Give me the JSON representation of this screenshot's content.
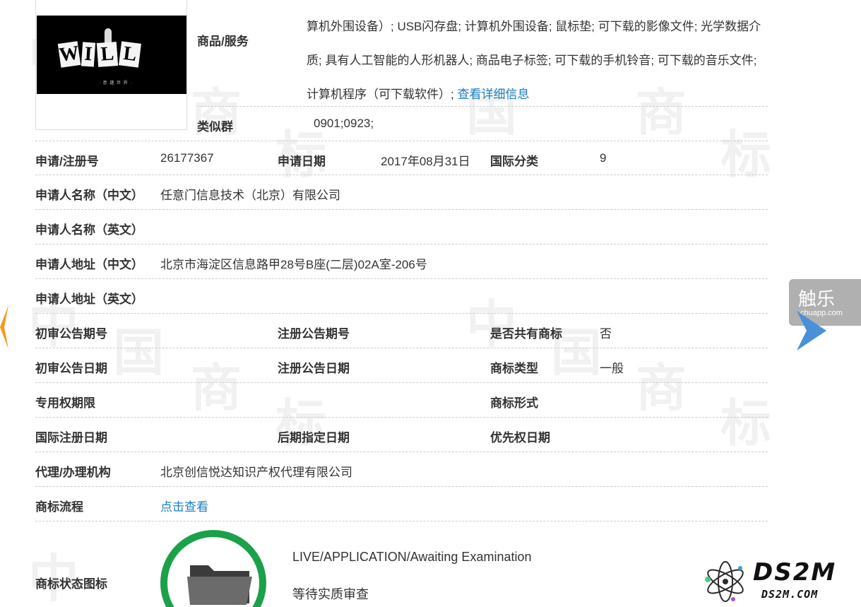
{
  "watermark": "中国商标",
  "logo": {
    "alt": "WILL trademark image",
    "letters": [
      "W",
      "I",
      "L",
      "L"
    ],
    "subtitle": "· 意 趣 世 界 ·"
  },
  "goods": {
    "label": "商品/服务",
    "text": "算机外围设备）; USB闪存盘; 计算机外围设备; 鼠标垫; 可下载的影像文件; 光学数据介质; 具有人工智能的人形机器人; 商品电子标签; 可下载的手机铃音; 可下载的音乐文件; 计算机程序（可下载软件）; ",
    "link": "查看详细信息"
  },
  "similar_group": {
    "label": "类似群",
    "value": "0901;0923;"
  },
  "rows": {
    "reg": {
      "l1": "申请/注册号",
      "v1": "26177367",
      "l2": "申请日期",
      "v2": "2017年08月31日",
      "l3": "国际分类",
      "v3": "9"
    },
    "name_cn": {
      "label": "申请人名称（中文）",
      "value": "任意门信息技术（北京）有限公司"
    },
    "name_en": {
      "label": "申请人名称（英文）",
      "value": ""
    },
    "addr_cn": {
      "label": "申请人地址（中文）",
      "value": "北京市海淀区信息路甲28号B座(二层)02A室-206号"
    },
    "addr_en": {
      "label": "申请人地址（英文）",
      "value": ""
    },
    "pub": {
      "l1": "初审公告期号",
      "l2": "注册公告期号",
      "l3": "是否共有商标",
      "v3": "否"
    },
    "pubdate": {
      "l1": "初审公告日期",
      "l2": "注册公告日期",
      "l3": "商标类型",
      "v3": "一般"
    },
    "excl": {
      "l1": "专用权期限",
      "l3": "商标形式"
    },
    "intl": {
      "l1": "国际注册日期",
      "l2": "后期指定日期",
      "l3": "优先权日期"
    },
    "agent": {
      "label": "代理/办理机构",
      "value": "北京创信悦达知识产权代理有限公司"
    },
    "flow": {
      "label": "商标流程",
      "link": "点击查看"
    }
  },
  "status": {
    "label": "商标状态图标",
    "en": "LIVE/APPLICATION/Awaiting Examination",
    "cn": "等待实质审查"
  },
  "overlays": {
    "chuapp_title": "触乐",
    "chuapp_url": "chuapp.com",
    "ds2m_big": "DS2M",
    "ds2m_small": "DS2M.COM"
  },
  "colors": {
    "link": "#1a7fc1",
    "status_ring": "#1aa14a",
    "arrow_left": "#f39a1e",
    "arrow_right": "#4a90d9"
  }
}
